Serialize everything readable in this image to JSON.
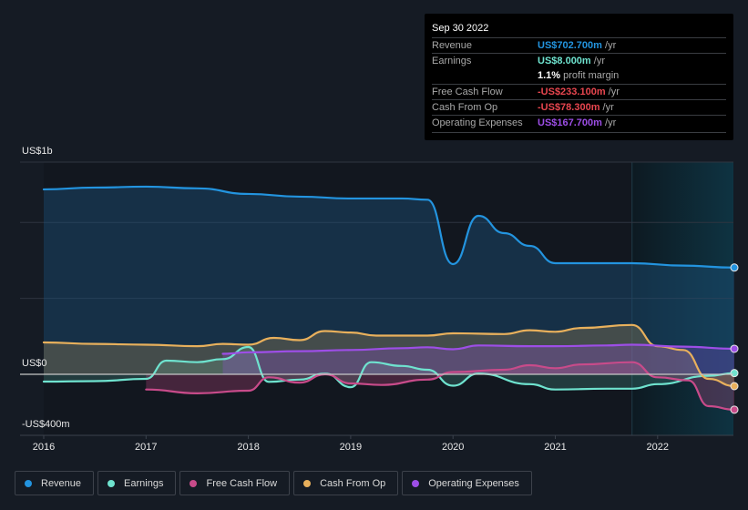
{
  "chart_data": {
    "type": "area",
    "title": "",
    "xlabel": "",
    "ylabel": "",
    "y_unit": "US$ millions",
    "ylim": [
      -400,
      1400
    ],
    "y_tick_labels": [
      {
        "value": 1000,
        "label": "US$1b"
      },
      {
        "value": 0,
        "label": "US$0"
      },
      {
        "value": -400,
        "label": "-US$400m"
      }
    ],
    "x_ticks": [
      2016,
      2017,
      2018,
      2019,
      2020,
      2021,
      2022
    ],
    "xlim": [
      2015.7,
      2022.75
    ],
    "forecast_region_start": 2021.75,
    "grid": true,
    "legend_position": "bottom-left",
    "series": [
      {
        "name": "Revenue",
        "color": "#2394df",
        "x": [
          2016.0,
          2016.5,
          2017.0,
          2017.5,
          2018.0,
          2018.5,
          2019.0,
          2019.5,
          2019.75,
          2020.0,
          2020.25,
          2020.5,
          2020.75,
          2021.0,
          2021.5,
          2021.75,
          2022.25,
          2022.75
        ],
        "values": [
          1218,
          1230,
          1236,
          1225,
          1188,
          1170,
          1158,
          1158,
          1150,
          726,
          1044,
          930,
          846,
          732,
          732,
          732,
          716,
          703
        ]
      },
      {
        "name": "Earnings",
        "color": "#6fe3cf",
        "x": [
          2016.0,
          2016.5,
          2017.0,
          2017.2,
          2017.5,
          2017.75,
          2018.0,
          2018.2,
          2018.5,
          2018.75,
          2019.0,
          2019.2,
          2019.5,
          2019.75,
          2020.0,
          2020.25,
          2020.75,
          2021.0,
          2021.5,
          2021.75,
          2022.0,
          2022.5,
          2022.75
        ],
        "values": [
          -48,
          -45,
          -30,
          90,
          80,
          100,
          180,
          -50,
          -35,
          5,
          -85,
          80,
          55,
          30,
          -75,
          5,
          -65,
          -100,
          -95,
          -95,
          -65,
          -10,
          8
        ]
      },
      {
        "name": "Free Cash Flow",
        "color": "#c84b8a",
        "x": [
          2017.0,
          2017.5,
          2018.0,
          2018.2,
          2018.5,
          2018.75,
          2019.0,
          2019.3,
          2019.75,
          2020.0,
          2020.5,
          2020.75,
          2021.0,
          2021.25,
          2021.75,
          2022.0,
          2022.3,
          2022.5,
          2022.75
        ],
        "values": [
          -100,
          -125,
          -108,
          -20,
          -55,
          0,
          -60,
          -70,
          -35,
          15,
          30,
          60,
          40,
          65,
          80,
          -20,
          -40,
          -210,
          -233
        ]
      },
      {
        "name": "Cash From Op",
        "color": "#e8b05c",
        "x": [
          2016.0,
          2016.5,
          2017.0,
          2017.5,
          2017.75,
          2018.0,
          2018.25,
          2018.5,
          2018.75,
          2019.0,
          2019.25,
          2019.75,
          2020.0,
          2020.5,
          2020.75,
          2021.0,
          2021.25,
          2021.75,
          2022.0,
          2022.25,
          2022.5,
          2022.75
        ],
        "values": [
          210,
          200,
          195,
          185,
          200,
          195,
          240,
          225,
          285,
          275,
          255,
          255,
          270,
          265,
          290,
          280,
          305,
          325,
          185,
          160,
          -30,
          -78
        ]
      },
      {
        "name": "Operating Expenses",
        "color": "#9d4ee6",
        "x": [
          2017.75,
          2018.0,
          2018.5,
          2019.0,
          2019.5,
          2019.75,
          2020.0,
          2020.25,
          2020.75,
          2021.0,
          2021.5,
          2021.75,
          2022.25,
          2022.75
        ],
        "values": [
          135,
          145,
          152,
          160,
          172,
          178,
          165,
          190,
          185,
          185,
          190,
          195,
          182,
          168
        ]
      }
    ]
  },
  "tooltip": {
    "date": "Sep 30 2022",
    "rows": [
      {
        "label": "Revenue",
        "value": "US$702.700m",
        "unit": " /yr",
        "color": "#2394df"
      },
      {
        "label": "Earnings",
        "value": "US$8.000m",
        "unit": " /yr",
        "color": "#6fe3cf"
      },
      {
        "label": "",
        "value": "1.1%",
        "unit": " profit margin",
        "color": "#ffffff"
      },
      {
        "label": "Free Cash Flow",
        "value": "-US$233.100m",
        "unit": " /yr",
        "color": "#e8464f"
      },
      {
        "label": "Cash From Op",
        "value": "-US$78.300m",
        "unit": " /yr",
        "color": "#e8464f"
      },
      {
        "label": "Operating Expenses",
        "value": "US$167.700m",
        "unit": " /yr",
        "color": "#9d4ee6"
      }
    ]
  },
  "legend": [
    {
      "label": "Revenue",
      "color": "#2394df"
    },
    {
      "label": "Earnings",
      "color": "#6fe3cf"
    },
    {
      "label": "Free Cash Flow",
      "color": "#c84b8a"
    },
    {
      "label": "Cash From Op",
      "color": "#e8b05c"
    },
    {
      "label": "Operating Expenses",
      "color": "#9d4ee6"
    }
  ]
}
